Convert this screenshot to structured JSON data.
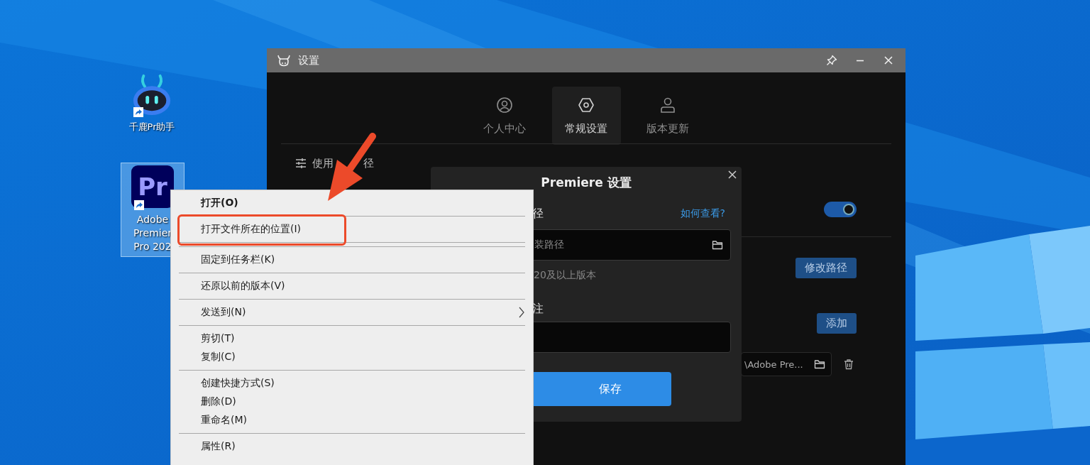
{
  "desktop_icons": [
    {
      "kind": "robot",
      "label_lines": [
        "千鹿Pr助手"
      ],
      "selected": false
    },
    {
      "kind": "premiere",
      "logo_text": "Pr",
      "label_lines": [
        "Adobe",
        "Premier",
        "Pro 202"
      ],
      "selected": true
    }
  ],
  "settings_window": {
    "title": "设置",
    "tabs": [
      {
        "label": "个人中心",
        "selected": false
      },
      {
        "label": "常规设置",
        "selected": true
      },
      {
        "label": "版本更新",
        "selected": false
      }
    ],
    "section_label_parts": [
      "使用",
      "径"
    ],
    "toggle": {
      "on": true
    },
    "change_path_button": "修改路径",
    "add_button": "添加",
    "path_field": {
      "value": "\\Adobe Pre..."
    }
  },
  "dialog": {
    "title": "Premiere 设置",
    "path_label": "径",
    "help_link": "如何查看?",
    "path_field": {
      "placeholder": "装路径"
    },
    "hint": "20及以上版本",
    "note_label": "注",
    "save_button": "保存"
  },
  "context_menu": [
    {
      "kind": "item",
      "label": "打开(O)",
      "default": true,
      "submenu": false
    },
    {
      "kind": "separator"
    },
    {
      "kind": "item",
      "label": "打开文件所在的位置(I)",
      "default": false,
      "submenu": false
    },
    {
      "kind": "separator"
    },
    {
      "kind": "separator"
    },
    {
      "kind": "item",
      "label": "固定到任务栏(K)",
      "default": false,
      "submenu": false
    },
    {
      "kind": "separator"
    },
    {
      "kind": "item",
      "label": "还原以前的版本(V)",
      "default": false,
      "submenu": false
    },
    {
      "kind": "separator"
    },
    {
      "kind": "item",
      "label": "发送到(N)",
      "default": false,
      "submenu": true
    },
    {
      "kind": "separator"
    },
    {
      "kind": "item",
      "label": "剪切(T)",
      "default": false,
      "submenu": false
    },
    {
      "kind": "item",
      "label": "复制(C)",
      "default": false,
      "submenu": false
    },
    {
      "kind": "separator"
    },
    {
      "kind": "item",
      "label": "创建快捷方式(S)",
      "default": false,
      "submenu": false
    },
    {
      "kind": "item",
      "label": "删除(D)",
      "default": false,
      "submenu": false
    },
    {
      "kind": "item",
      "label": "重命名(M)",
      "default": false,
      "submenu": false
    },
    {
      "kind": "separator"
    },
    {
      "kind": "item",
      "label": "属性(R)",
      "default": false,
      "submenu": false
    }
  ]
}
